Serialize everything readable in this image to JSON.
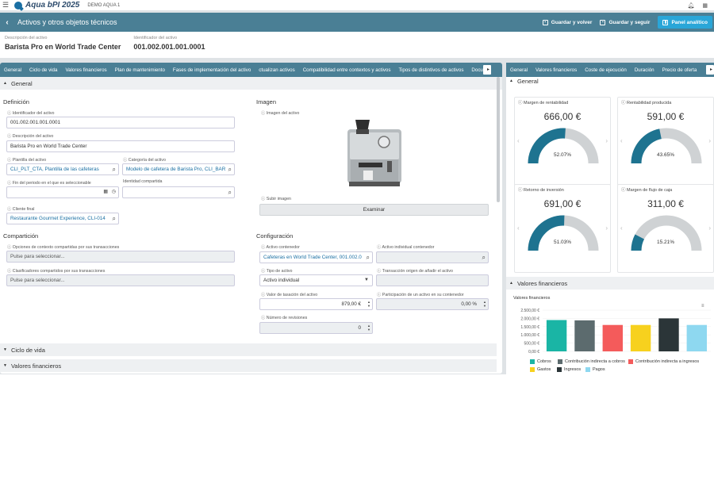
{
  "app": {
    "brand": "Aqua bPI 2025",
    "environment": "DEMO AQUA 1",
    "bell_icon": "bell-icon",
    "menu_icon": "grid-menu-icon"
  },
  "header": {
    "title": "Activos y otros objetos técnicos",
    "save_back": "Guardar y volver",
    "save_continue": "Guardar y seguir",
    "analytics": "Panel analítico"
  },
  "info": {
    "desc_label": "Descripción del activo",
    "desc_value": "Barista Pro en World Trade Center",
    "id_label": "Identificador del activo",
    "id_value": "001.002.001.001.0001"
  },
  "left_tabs": [
    "General",
    "Ciclo de vida",
    "Valores financieros",
    "Plan de mantenimiento",
    "Fases de implementación del activo",
    "ctualizan activos",
    "Compatibilidad entre contextos y activos",
    "Tipos de distintivos de activos",
    "Docu"
  ],
  "sections": {
    "general": "General",
    "ciclo": "Ciclo de vida",
    "valores": "Valores financieros"
  },
  "definicion": {
    "title": "Definición",
    "id_label": "Identificador del activo",
    "id_value": "001.002.001.001.0001",
    "desc_label": "Descripción del activo",
    "desc_value": "Barista Pro en World Trade Center",
    "plantilla_label": "Plantilla del activo",
    "plantilla_value": "CLI_PLT_CTA, Plantilla de las cafeteras",
    "categoria_label": "Categoría del activo",
    "categoria_value": "Modelo de cafetera de Barista Pro, CLI_BAR",
    "fin_label": "Fin del periodo en el que es seleccionable",
    "identidad_label": "Identidad compartida",
    "cliente_label": "Cliente final",
    "cliente_value": "Restaurante Gourmet Experience, CLI-014"
  },
  "imagen": {
    "title": "Imagen",
    "label": "Imagen del activo",
    "subir_label": "Subir imagen",
    "examinar": "Examinar"
  },
  "comparticion": {
    "title": "Compartición",
    "opciones_label": "Opciones de contexto compartidas por sus transacciones",
    "opciones_placeholder": "Pulse para seleccionar...",
    "clasif_label": "Clasificadores compartidos por sus transacciones",
    "clasif_placeholder": "Pulse para seleccionar..."
  },
  "configuracion": {
    "title": "Configuración",
    "contenedor_label": "Activo contenedor",
    "contenedor_value": "Cafeteras en World Trade Center, 001.002.0",
    "individual_label": "Activo individual contenedor",
    "tipo_label": "Tipo de activo",
    "tipo_value": "Activo individual",
    "transaccion_label": "Transacción origen de añadir el activo",
    "tasacion_label": "Valor de tasación del activo",
    "tasacion_value": "879,00 €",
    "participacion_label": "Participación de un activo en su contenedor",
    "participacion_value": "0,00 %",
    "revisiones_label": "Número de revisiones",
    "revisiones_value": "0"
  },
  "right_tabs": [
    "General",
    "Valores financieros",
    "Coste de ejecución",
    "Duración",
    "Precio de oferta"
  ],
  "kpis": [
    {
      "label": "Margen de rentabilidad",
      "value": "666,00 €",
      "pct": "52.07%",
      "fraction": 0.5207
    },
    {
      "label": "Rentabilidad producida",
      "value": "591,00 €",
      "pct": "43.65%",
      "fraction": 0.4365
    },
    {
      "label": "Retorno de inversión",
      "value": "691,00 €",
      "pct": "51.03%",
      "fraction": 0.5103
    },
    {
      "label": "Margen de flujo de caja",
      "value": "311,00 €",
      "pct": "15.21%",
      "fraction": 0.1521
    }
  ],
  "gauge_colors": {
    "fill": "#1e7390",
    "track": "#cfd2d4"
  },
  "financial": {
    "section": "Valores financieros",
    "chart_title": "Valores financieros"
  },
  "chart_data": {
    "type": "bar",
    "title": "Valores financieros",
    "ylim": [
      0,
      2500
    ],
    "yticks": [
      "2.500,00 €",
      "2.000,00 €",
      "1.500,00 €",
      "1.000,00 €",
      "500,00 €",
      "0,00 €"
    ],
    "series": [
      {
        "name": "Cobros",
        "value": 1900,
        "color": "#1ab5a5"
      },
      {
        "name": "Contribución indirecta a cobros",
        "value": 1880,
        "color": "#5c6b6e"
      },
      {
        "name": "Contribución indirecta a ingresos",
        "value": 1600,
        "color": "#f45b5b"
      },
      {
        "name": "Gastos",
        "value": 1600,
        "color": "#f7d11e"
      },
      {
        "name": "Ingresos",
        "value": 2000,
        "color": "#2b3538"
      },
      {
        "name": "Pagos",
        "value": 1600,
        "color": "#8ed8f0"
      }
    ]
  }
}
